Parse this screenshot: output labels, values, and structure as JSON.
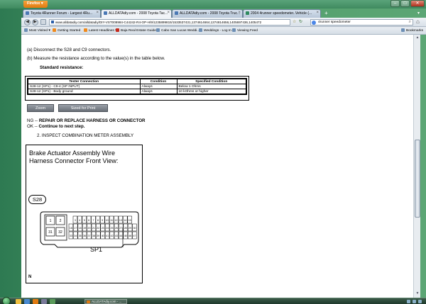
{
  "browser": {
    "app_button": "Firefox",
    "tabs": [
      {
        "label": "Toyota 4Runner Forum - Largest 4Ru..."
      },
      {
        "label": "ALLDATAdiy.com - 2008 Toyota Tac..."
      },
      {
        "label": "ALLDATAdiy.com - 2008 Toyota Truc..."
      },
      {
        "label": "2004 4runner speedometer..Vehicle (..."
      }
    ],
    "url": "www.alldatadiy.com/alldatadiy/DIY-VST008984-C44242-R4-OP-H/9/1235899815/1533537431,1374614664,1374814656,1405697436,1405472",
    "search_value": "4runner speedometer",
    "bookmarks": [
      "Most Visited",
      "Getting Started",
      "Latest Headlines",
      "Baja Real Estate Guide ...",
      "Cabo San Lucas Weddi...",
      "Weddings - Log In",
      "Viewing Feed"
    ],
    "bookmarks_right": "Bookmarks"
  },
  "page": {
    "step_a": "(a)   Disconnect the S28 and C9 connectors.",
    "step_b": "(b)   Measure the resistance according to the value(s) in the table below.",
    "standard_heading": "Standard resistance:",
    "table": {
      "headers": [
        "Tester Connection",
        "Condition",
        "Specified Condition"
      ],
      "rows": [
        [
          "S28-12 (SP1) - C9-4 (SP INPUT)",
          "Always",
          "Below 1 Ohms"
        ],
        [
          "S28-12 (SP1) - Body ground",
          "Always",
          "10 kOhms or higher"
        ]
      ]
    },
    "zoom_button": "Zoom",
    "sized_print_button": "Sized for Print",
    "ng_prefix": "NG -- ",
    "ng_text": "REPAIR OR REPLACE HARNESS OR CONNECTOR",
    "ok_prefix": "OK -- ",
    "ok_text": "Continue to next step.",
    "step_2": "2.   INSPECT COMBINATION METER ASSEMBLY",
    "figure": {
      "title_line1": "Brake Actuator Assembly Wire",
      "title_line2": "Harness Connector Front View:",
      "tag": "S28",
      "pins_left": [
        "1",
        "2",
        "31",
        "32"
      ],
      "pins_row1": [
        "3",
        "4",
        "5",
        "6",
        "7",
        "8",
        "9",
        "10",
        "11",
        "12",
        "13",
        "14",
        "15"
      ],
      "pins_row2": [
        "16",
        "17",
        "18",
        "19",
        "20",
        "21",
        "22",
        "23",
        "24",
        "25",
        "26",
        "27",
        "28",
        "29",
        "30"
      ],
      "pins_row3": [
        "33",
        "34",
        "35",
        "36",
        "37",
        "38",
        "39",
        "40",
        "41",
        "42",
        "43",
        "44",
        "45",
        "46",
        "47"
      ],
      "callout": "SP1",
      "corner_label": "N"
    }
  },
  "taskbar": {
    "task_label": "ALLDATAdiy.com - ..."
  },
  "colors": {
    "firefox_orange": "#e88a20",
    "desktop_green": "#4f9c68",
    "button_grey": "#7a8088"
  }
}
